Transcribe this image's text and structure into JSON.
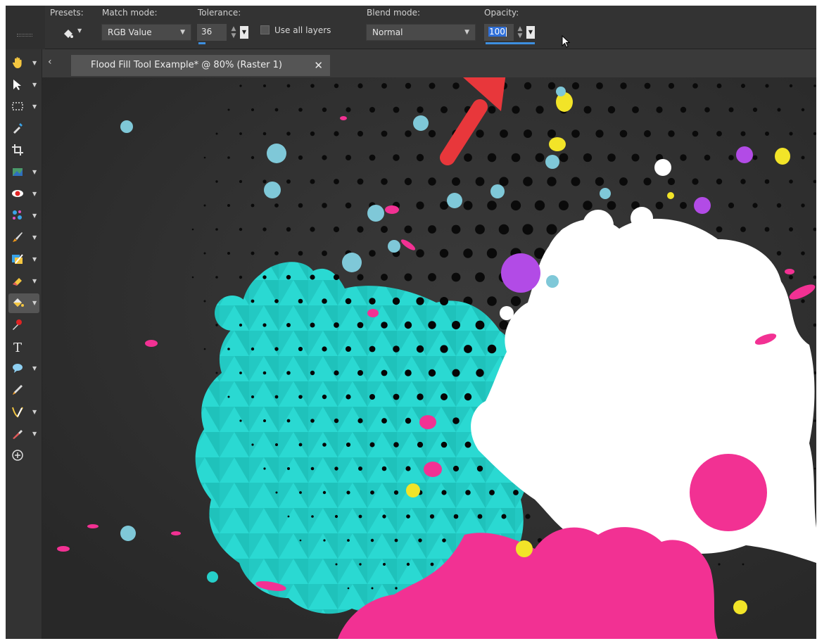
{
  "options_bar": {
    "presets_label": "Presets:",
    "match_mode_label": "Match mode:",
    "match_mode_value": "RGB Value",
    "tolerance_label": "Tolerance:",
    "tolerance_value": "36",
    "use_all_layers_label": "Use all layers",
    "use_all_layers_checked": false,
    "blend_mode_label": "Blend mode:",
    "blend_mode_value": "Normal",
    "opacity_label": "Opacity:",
    "opacity_value": "100"
  },
  "document_tab": {
    "title": "Flood Fill Tool Example* @  80% (Raster 1)"
  },
  "toolbar": {
    "tools": [
      {
        "icon": "pan-icon"
      },
      {
        "icon": "pick-icon"
      },
      {
        "icon": "selection-icon"
      },
      {
        "icon": "dropper-icon"
      },
      {
        "icon": "crop-icon"
      },
      {
        "icon": "straighten-icon"
      },
      {
        "icon": "red-eye-icon"
      },
      {
        "icon": "makeover-icon"
      },
      {
        "icon": "paint-brush-icon"
      },
      {
        "icon": "clone-brush-icon"
      },
      {
        "icon": "eraser-icon"
      },
      {
        "icon": "flood-fill-icon"
      },
      {
        "icon": "color-changer-icon"
      },
      {
        "icon": "text-icon"
      },
      {
        "icon": "preset-shape-icon"
      },
      {
        "icon": "pen-icon"
      },
      {
        "icon": "warp-brush-icon"
      },
      {
        "icon": "picture-tube-icon"
      },
      {
        "icon": "add-tool-icon"
      }
    ]
  },
  "colors": {
    "accent_selection": "#3d8fe0",
    "annotation_arrow": "#e8373b",
    "teal": "#22d3cc",
    "pink": "#f23193",
    "purple": "#b24be6",
    "yellow": "#f2e428",
    "light_blue": "#7fc8d8"
  }
}
